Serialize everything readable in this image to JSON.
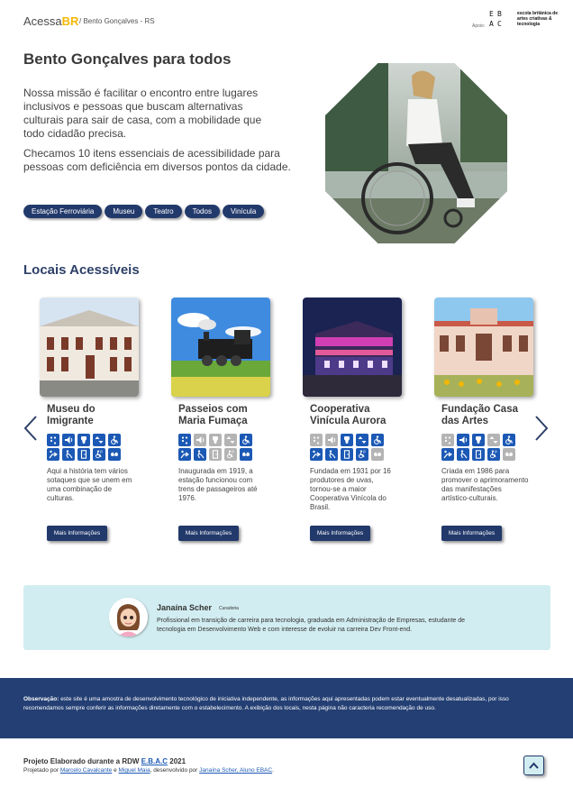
{
  "header": {
    "logo_text": "Acessa",
    "logo_accent": "BR",
    "breadcrumb": "/ Bento Gonçalves - RS",
    "support_label": "Apoio:",
    "support_mark": "EBAC",
    "support_text": "escola britânica de artes criativas & tecnologia"
  },
  "hero": {
    "title": "Bento Gonçalves para todos",
    "paragraph1": "Nossa missão é facilitar o encontro entre lugares inclusivos e pessoas que buscam alternativas culturais para sair de casa, com a mobilidade que todo cidadão precisa.",
    "paragraph2": "Checamos 10 itens essenciais de acessibilidade para pessoas com deficiência em diversos pontos da cidade.",
    "filters": [
      "Estação Ferroviária",
      "Museu",
      "Teatro",
      "Todos",
      "Vinícula"
    ]
  },
  "locais": {
    "title": "Locais Acessíveis",
    "more_label": "Mais Informações",
    "cards": [
      {
        "title": "Museu do Imigrante",
        "description": "Aqui a história tem vários sotaques que se unem em uma combinação de culturas.",
        "icons": [
          "braille-icon",
          "audio-icon",
          "toilet-icon",
          "elevator-icon",
          "wheelchair-icon",
          "accessible-route-icon",
          "blind-icon",
          "door-icon",
          "accessible-parking-icon",
          "sign-language-icon"
        ],
        "available": [
          true,
          true,
          true,
          true,
          true,
          true,
          true,
          true,
          true,
          true
        ]
      },
      {
        "title": "Passeios com Maria Fumaça",
        "description": "Inaugurada em 1919, a estação funcionou com trens de passageiros até 1976.",
        "icons": [
          "braille-icon",
          "audio-icon",
          "toilet-icon",
          "elevator-icon",
          "wheelchair-icon",
          "accessible-route-icon",
          "blind-icon",
          "door-icon",
          "accessible-parking-icon",
          "sign-language-icon"
        ],
        "available": [
          true,
          false,
          false,
          false,
          true,
          true,
          true,
          false,
          false,
          true
        ]
      },
      {
        "title": "Cooperativa Vinícula Aurora",
        "description": "Fundada em 1931 por 16 produtores de uvas, tornou-se a maior Cooperativa Vinícola do Brasil.",
        "icons": [
          "braille-icon",
          "audio-icon",
          "toilet-icon",
          "elevator-icon",
          "wheelchair-icon",
          "accessible-route-icon",
          "blind-icon",
          "door-icon",
          "accessible-parking-icon",
          "sign-language-icon"
        ],
        "available": [
          false,
          false,
          true,
          true,
          true,
          true,
          true,
          true,
          true,
          false
        ]
      },
      {
        "title": "Fundação Casa das Artes",
        "description": "Criada em 1986 para promover o aprimoramento das manifestações artístico-culturais.",
        "icons": [
          "braille-icon",
          "audio-icon",
          "toilet-icon",
          "elevator-icon",
          "wheelchair-icon",
          "accessible-route-icon",
          "blind-icon",
          "door-icon",
          "accessible-parking-icon",
          "sign-language-icon"
        ],
        "available": [
          false,
          true,
          true,
          false,
          true,
          true,
          true,
          true,
          true,
          false
        ]
      }
    ]
  },
  "curator": {
    "name": "Janaína Scher",
    "role": "Curadoria",
    "bio": "Profissional em transição de carreira para tecnologia, graduada em Administração de Empresas, estudante de tecnologia em Desenvolvimento Web e com interesse de evoluir na carreira Dev Front-end."
  },
  "footer": {
    "notice_label": "Observação:",
    "notice_text": " este site é uma amostra de desenvolvimento tecnológico de iniciativa independente, as informações aqui apresentadas podem estar eventualmente desatualizadas, por isso recomendamos sempre conferir as informações diretamente com o estabelecimento. A exibição dos locais, nesta página não caracteria recomendação de uso.",
    "project_prefix": "Projeto Elaborado durante a RDW ",
    "project_link": "E.B.A.C",
    "project_suffix": " 2021",
    "designed_prefix": "Projetado por ",
    "designer1": "Marcelo Cavalcante",
    "designed_and": " e ",
    "designer2": "Miguel Maia",
    "developed_prefix": ", desenvolvido por ",
    "developer": "Janaína Scher, Aluno EBAC",
    "developed_suffix": "."
  },
  "colors": {
    "navy": "#22396b",
    "icon_blue": "#1c59b5",
    "icon_off": "#b4b4b4",
    "accent_yellow": "#f2b705",
    "light_cyan": "#d2edf1"
  }
}
